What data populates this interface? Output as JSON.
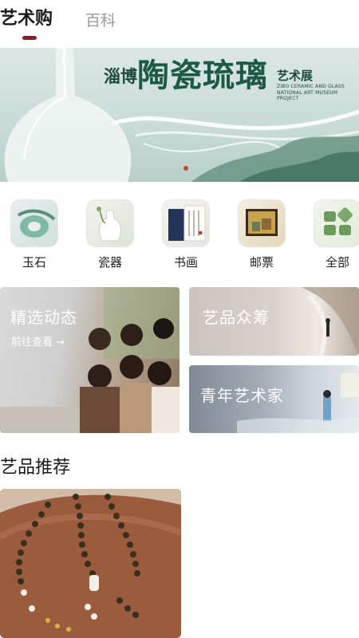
{
  "tabs": [
    {
      "label": "艺术购",
      "active": true
    },
    {
      "label": "百科",
      "active": false
    }
  ],
  "banner": {
    "subtitle": "淄博",
    "title": "陶瓷琉璃",
    "tag": "艺术展",
    "english_line1": "ZIBO CERAMIC AND GLASS",
    "english_line2": "NATIONAL ART MUSEUM PROJECT",
    "indicator_color": "#c8442f"
  },
  "categories": [
    {
      "label": "玉石",
      "icon": "jade-icon"
    },
    {
      "label": "瓷器",
      "icon": "vase-icon"
    },
    {
      "label": "书画",
      "icon": "calligraphy-icon"
    },
    {
      "label": "邮票",
      "icon": "stamp-icon"
    },
    {
      "label": "全部",
      "icon": "grid-icon"
    }
  ],
  "features": {
    "featured": {
      "title": "精选动态",
      "link": "前往查看 →"
    },
    "crowdfunding": {
      "title": "艺品众筹"
    },
    "young_artists": {
      "title": "青年艺术家"
    }
  },
  "recommend": {
    "section_title": "艺品推荐"
  },
  "colors": {
    "accent": "#8b1e2b",
    "inactive_tab": "#9a9a9a"
  }
}
